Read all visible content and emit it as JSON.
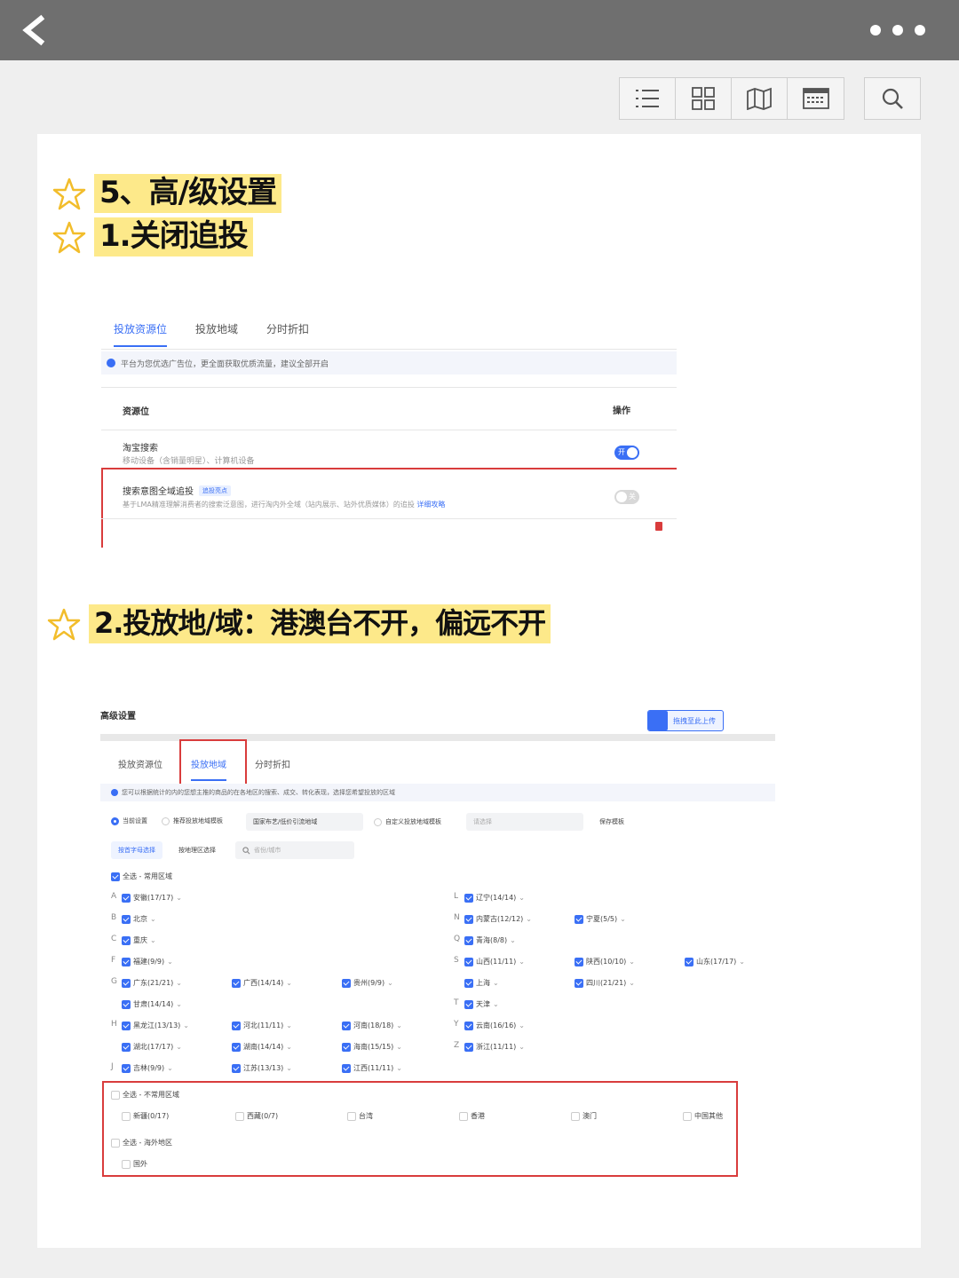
{
  "header": {
    "back_icon": "chevron-left-icon",
    "more_icon": "more-dots-icon"
  },
  "view_toolbar": {
    "icons": [
      "list-icon",
      "grid-icon",
      "map-icon",
      "calendar-icon"
    ],
    "search_icon": "search-icon"
  },
  "headings": {
    "h1": "5、高/级设置",
    "h2": "1.关闭追投",
    "h3": "2.投放地/域：港澳台不开，偏远不开"
  },
  "section1": {
    "tabs": [
      "投放资源位",
      "投放地域",
      "分时折扣"
    ],
    "info": "平台为您优选广告位，更全面获取优质流量，建议全部开启",
    "col_resource": "资源位",
    "col_action": "操作",
    "row1_title": "淘宝搜索",
    "row1_desc": "移动设备（含销量明星）、计算机设备",
    "row1_toggle": "开",
    "row2_title": "搜索意图全域追投",
    "row2_tag": "追投亮点",
    "row2_desc": "基于LMA精准理解消费者的搜索泛意图，进行淘内外全域（站内展示、站外优质媒体）的追投",
    "row2_link": "详细攻略",
    "row2_toggle": "关"
  },
  "section2": {
    "title": "高级设置",
    "upload_btn": "拖拽至此上传",
    "tabs": [
      "投放资源位",
      "投放地域",
      "分时折扣"
    ],
    "info": "您可以根据统计的内的您想主推的商品的在各地区的搜索、成交、转化表现，选择您希望投放的区域",
    "opt_current": "当前设置",
    "opt_template": "推荐投放地域模板",
    "select_value": "国家布艺/低价引流地域",
    "opt_custom": "自定义投放地域模板",
    "select_placeholder": "请选择",
    "save_template": "保存模板",
    "mode_letter": "按首字母选择",
    "mode_region": "按地理区选择",
    "search_placeholder": "省份/城市",
    "common_all": "全选 - 常用区域",
    "provinces": [
      {
        "letter": "A",
        "name": "安徽(17/17)",
        "col": 0,
        "row": 0
      },
      {
        "letter": "L",
        "name": "辽宁(14/14)",
        "col": 3,
        "row": 0
      },
      {
        "letter": "B",
        "name": "北京",
        "col": 0,
        "row": 1
      },
      {
        "letter": "N",
        "name": "内蒙古(12/12)",
        "col": 3,
        "row": 1
      },
      {
        "letter": "",
        "name": "宁夏(5/5)",
        "col": 4,
        "row": 1
      },
      {
        "letter": "C",
        "name": "重庆",
        "col": 0,
        "row": 2
      },
      {
        "letter": "Q",
        "name": "青海(8/8)",
        "col": 3,
        "row": 2
      },
      {
        "letter": "F",
        "name": "福建(9/9)",
        "col": 0,
        "row": 3
      },
      {
        "letter": "S",
        "name": "山西(11/11)",
        "col": 3,
        "row": 3
      },
      {
        "letter": "",
        "name": "陕西(10/10)",
        "col": 4,
        "row": 3
      },
      {
        "letter": "",
        "name": "山东(17/17)",
        "col": 5,
        "row": 3
      },
      {
        "letter": "G",
        "name": "广东(21/21)",
        "col": 0,
        "row": 4
      },
      {
        "letter": "",
        "name": "广西(14/14)",
        "col": 1,
        "row": 4
      },
      {
        "letter": "",
        "name": "贵州(9/9)",
        "col": 2,
        "row": 4
      },
      {
        "letter": "",
        "name": "上海",
        "col": 3,
        "row": 4
      },
      {
        "letter": "",
        "name": "四川(21/21)",
        "col": 4,
        "row": 4
      },
      {
        "letter": "",
        "name": "甘肃(14/14)",
        "col": 0,
        "row": 5
      },
      {
        "letter": "T",
        "name": "天津",
        "col": 3,
        "row": 5
      },
      {
        "letter": "H",
        "name": "黑龙江(13/13)",
        "col": 0,
        "row": 6
      },
      {
        "letter": "",
        "name": "河北(11/11)",
        "col": 1,
        "row": 6
      },
      {
        "letter": "",
        "name": "河南(18/18)",
        "col": 2,
        "row": 6
      },
      {
        "letter": "Y",
        "name": "云南(16/16)",
        "col": 3,
        "row": 6
      },
      {
        "letter": "",
        "name": "湖北(17/17)",
        "col": 0,
        "row": 7
      },
      {
        "letter": "",
        "name": "湖南(14/14)",
        "col": 1,
        "row": 7
      },
      {
        "letter": "",
        "name": "海南(15/15)",
        "col": 2,
        "row": 7
      },
      {
        "letter": "Z",
        "name": "浙江(11/11)",
        "col": 3,
        "row": 7
      },
      {
        "letter": "J",
        "name": "吉林(9/9)",
        "col": 0,
        "row": 8
      },
      {
        "letter": "",
        "name": "江苏(13/13)",
        "col": 1,
        "row": 8
      },
      {
        "letter": "",
        "name": "江西(11/11)",
        "col": 2,
        "row": 8
      }
    ],
    "uncommon_all": "全选 - 不常用区域",
    "uncommon": [
      "新疆(0/17)",
      "西藏(0/7)",
      "台湾",
      "香港",
      "澳门",
      "中国其他"
    ],
    "overseas_all": "全选 - 海外地区",
    "overseas": [
      "国外"
    ]
  },
  "colors": {
    "accent": "#3a6ff5",
    "highlight": "#fde98a",
    "red": "#d93c3c",
    "topbar": "#6f6f6f"
  }
}
